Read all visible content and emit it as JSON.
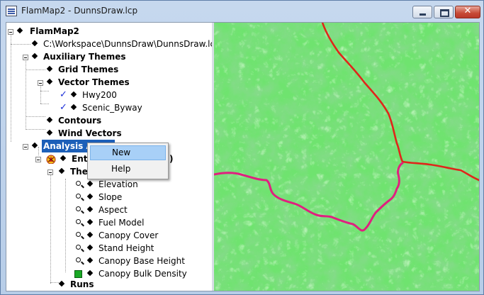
{
  "window": {
    "title": "FlamMap2 - DunnsDraw.lcp",
    "close_glyph": "✕"
  },
  "tree": {
    "root": "FlamMap2",
    "landscape_path": "C:\\Workspace\\DunnsDraw\\DunnsDraw.lcp",
    "auxiliary": "Auxiliary Themes",
    "grid": "Grid Themes",
    "vector": "Vector Themes",
    "vector_items": [
      "Hwy200",
      "Scenic_Byway"
    ],
    "contours": "Contours",
    "wind": "Wind Vectors",
    "analysis": "Analysis Areas",
    "entire_prefix": "Entir",
    "entire_suffix": ")",
    "themes_prefix": "The",
    "themes": [
      "Elevation",
      "Slope",
      "Aspect",
      "Fuel Model",
      "Canopy Cover",
      "Stand Height",
      "Canopy Base Height",
      "Canopy Bulk Density"
    ],
    "runs": "Runs"
  },
  "context_menu": {
    "items": [
      "New",
      "Help"
    ],
    "highlighted": "New"
  },
  "map": {
    "icon": "terrain-map",
    "colors": {
      "base": "#6fe36f",
      "light": "#97f093",
      "dark": "#3fa844",
      "road_red": "#e0261a",
      "road_pink": "#e0207f"
    }
  }
}
